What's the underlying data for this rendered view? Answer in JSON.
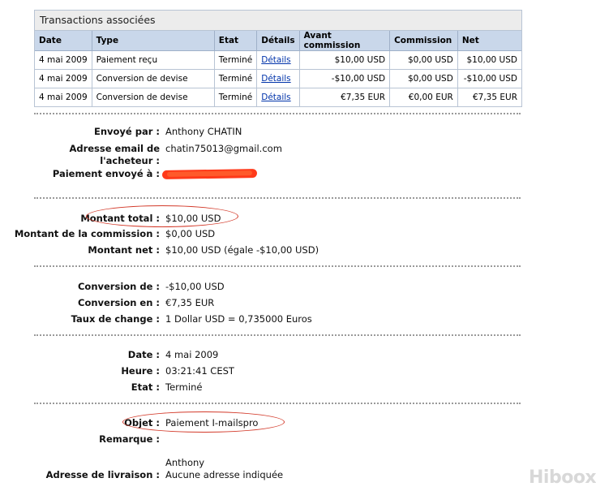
{
  "transactions": {
    "caption": "Transactions associées",
    "headers": [
      "Date",
      "Type",
      "Etat",
      "Détails",
      "Avant commission",
      "Commission",
      "Net"
    ],
    "rows": [
      {
        "date": "4 mai 2009",
        "type": "Paiement reçu",
        "etat": "Terminé",
        "details": "Détails",
        "avant": "$10,00 USD",
        "commission": "$0,00 USD",
        "net": "$10,00 USD"
      },
      {
        "date": "4 mai 2009",
        "type": "Conversion de devise",
        "etat": "Terminé",
        "details": "Détails",
        "avant": "-$10,00 USD",
        "commission": "$0,00 USD",
        "net": "-$10,00 USD"
      },
      {
        "date": "4 mai 2009",
        "type": "Conversion de devise",
        "etat": "Terminé",
        "details": "Détails",
        "avant": "€7,35 EUR",
        "commission": "€0,00 EUR",
        "net": "€7,35 EUR"
      }
    ]
  },
  "sender": {
    "sent_by_label": "Envoyé par :",
    "sent_by_value": "Anthony CHATIN",
    "email_label_1": "Adresse email de",
    "email_label_2": "l'acheteur :",
    "email_value": "chatin75013@gmail.com",
    "sent_to_label": "Paiement envoyé à :"
  },
  "amounts": {
    "total_label": "Montant total :",
    "total_value": "$10,00 USD",
    "commission_label": "Montant de la commission :",
    "commission_value": "$0,00 USD",
    "net_label": "Montant net :",
    "net_value": "$10,00 USD (égale -$10,00 USD)"
  },
  "conversion": {
    "from_label": "Conversion de :",
    "from_value": "-$10,00 USD",
    "to_label": "Conversion en :",
    "to_value": "€7,35 EUR",
    "rate_label": "Taux de change :",
    "rate_value": "1 Dollar USD = 0,735000 Euros"
  },
  "timing": {
    "date_label": "Date :",
    "date_value": "4 mai 2009",
    "time_label": "Heure :",
    "time_value": "03:21:41 CEST",
    "status_label": "Etat :",
    "status_value": "Terminé"
  },
  "object": {
    "object_label": "Objet :",
    "object_value": "Paiement I-mailspro",
    "remark_label": "Remarque :",
    "remark_value": ""
  },
  "shipping": {
    "name": "Anthony",
    "label": "Adresse de livraison :",
    "value": "Aucune adresse indiquée"
  },
  "watermark": "Hiboox",
  "colors": {
    "header_bg": "#c9d7ea",
    "caption_bg": "#ececec",
    "link": "#0033aa",
    "annotation": "#d33a2a",
    "redaction": "#ff3a1a"
  }
}
